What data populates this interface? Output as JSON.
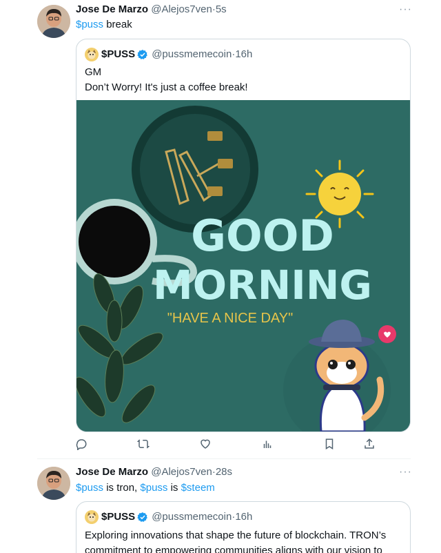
{
  "tweets": [
    {
      "author_name": "Jose De Marzo",
      "handle": "@Alejos7ven",
      "time": "5s",
      "text_parts": [
        {
          "text": "$puss",
          "tag": true
        },
        {
          "text": " break",
          "tag": false
        }
      ],
      "quote": {
        "name": "$PUSS",
        "handle": "@pussmemecoin",
        "time": "16h",
        "line1": "GM",
        "line2": "Don’t Worry! It's just a coffee break!",
        "image": {
          "headline1": "GOOD",
          "headline2": "MORNING",
          "tagline": "\"HAVE A NICE DAY\""
        }
      }
    },
    {
      "author_name": "Jose De Marzo",
      "handle": "@Alejos7ven",
      "time": "28s",
      "text_parts": [
        {
          "text": "$puss",
          "tag": true
        },
        {
          "text": " is tron, ",
          "tag": false
        },
        {
          "text": "$puss",
          "tag": true
        },
        {
          "text": " is ",
          "tag": false
        },
        {
          "text": "$steem",
          "tag": true
        }
      ],
      "quote": {
        "name": "$PUSS",
        "handle": "@pussmemecoin",
        "time": "16h",
        "line1": "Exploring innovations that shape the future of blockchain. TRON’s",
        "line2": "commitment to empowering communities aligns with our vision to"
      }
    }
  ],
  "actions": [
    "reply",
    "repost",
    "like",
    "views",
    "bookmark",
    "share"
  ],
  "colors": {
    "link": "#1d9bf0",
    "muted": "#536471",
    "border": "#cfd9de",
    "verified": "#1d9bf0",
    "image_bg": "#2b6a63",
    "headline": "#bdf2f0",
    "tagline": "#e6c44a"
  },
  "more_label": "···",
  "dot": "·"
}
